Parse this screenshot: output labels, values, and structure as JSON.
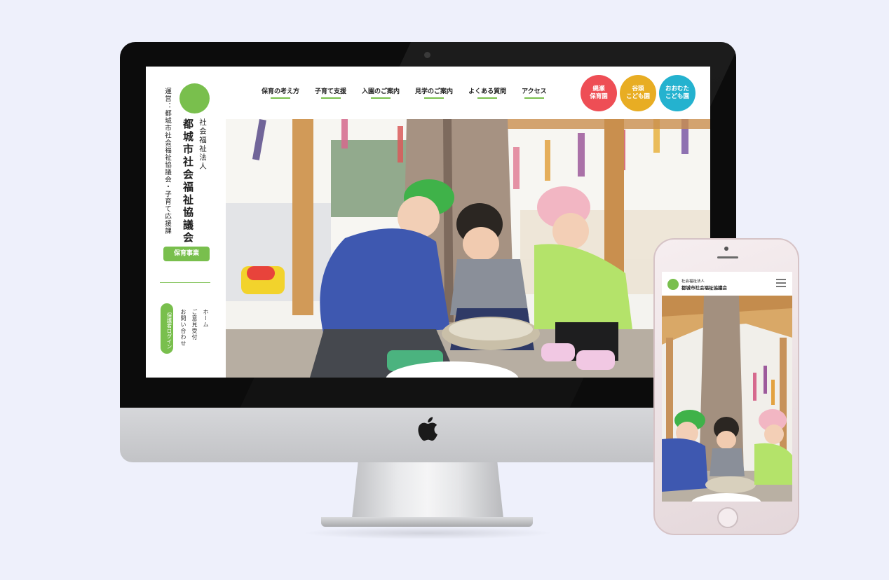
{
  "desktop": {
    "operator": "運営：都城市社会福祉協議会・子育て応援課",
    "corp_type": "社会福祉法人",
    "org_name": "都城市社会福祉協議会",
    "service_button": "保育事業",
    "login_button": "保護者ログイン",
    "side_links": [
      "ホーム",
      "ご意見受付",
      "お問い合わせ"
    ],
    "nav": [
      "保育の考え方",
      "子育て支援",
      "入園のご案内",
      "見学のご案内",
      "よくある質問",
      "アクセス"
    ],
    "facilities": [
      {
        "line1": "縄瀬",
        "line2": "保育園",
        "color": "#ee4e55"
      },
      {
        "line1": "谷頭",
        "line2": "こども園",
        "color": "#e8ad23"
      },
      {
        "line1": "おおむた",
        "line2": "こども園",
        "color": "#24b2cf"
      }
    ],
    "accent_color": "#79bf4d"
  },
  "mobile": {
    "corp_type": "社会福祉法人",
    "org_name": "都城市社会福祉協議会"
  },
  "icons": {
    "brand": "apple-logo-icon",
    "menu": "hamburger-menu-icon",
    "logo": "logo-circle-icon"
  }
}
